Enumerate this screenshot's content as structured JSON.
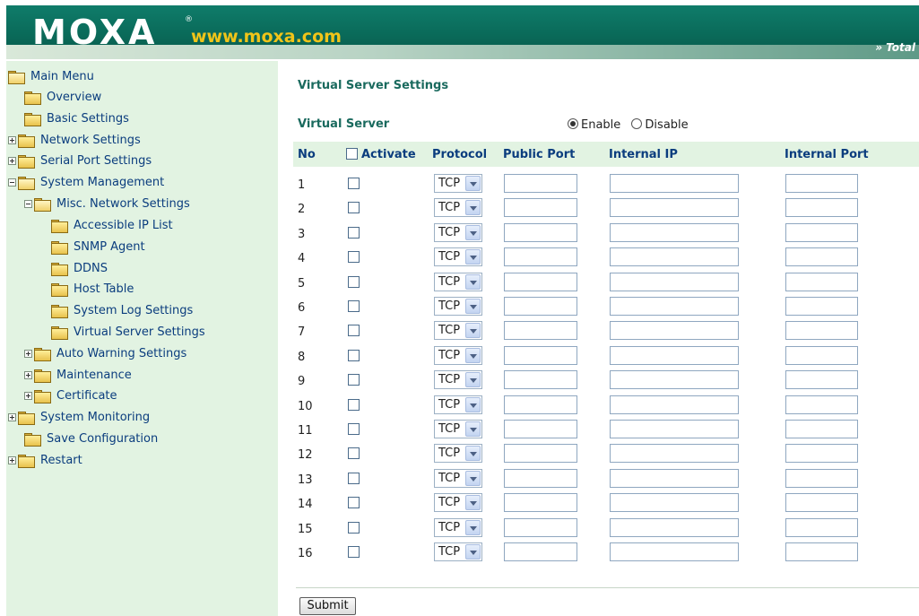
{
  "header": {
    "logo": "MOXA",
    "registered": "®",
    "url": "www.moxa.com",
    "tagline": "» Total"
  },
  "sidebar": {
    "items": [
      {
        "label": "Main Menu",
        "state": "open"
      },
      {
        "label": "Overview"
      },
      {
        "label": "Basic Settings"
      },
      {
        "label": "Network Settings",
        "state": "collapsed"
      },
      {
        "label": "Serial Port Settings",
        "state": "collapsed"
      },
      {
        "label": "System Management",
        "state": "open"
      },
      {
        "label": "Misc. Network Settings",
        "state": "open"
      },
      {
        "label": "Accessible IP List"
      },
      {
        "label": "SNMP Agent"
      },
      {
        "label": "DDNS"
      },
      {
        "label": "Host Table"
      },
      {
        "label": "System Log Settings"
      },
      {
        "label": "Virtual Server Settings"
      },
      {
        "label": "Auto Warning Settings",
        "state": "collapsed"
      },
      {
        "label": "Maintenance",
        "state": "collapsed"
      },
      {
        "label": "Certificate",
        "state": "collapsed"
      },
      {
        "label": "System Monitoring",
        "state": "collapsed"
      },
      {
        "label": "Save Configuration"
      },
      {
        "label": "Restart",
        "state": "collapsed"
      }
    ]
  },
  "main": {
    "title": "Virtual Server Settings",
    "virtual_server": {
      "label": "Virtual Server",
      "enable": "Enable",
      "disable": "Disable",
      "selected": "Enable"
    },
    "table": {
      "headers": {
        "no": "No",
        "activate": "Activate",
        "protocol": "Protocol",
        "public_port": "Public Port",
        "internal_ip": "Internal IP",
        "internal_port": "Internal Port"
      },
      "rows": [
        {
          "no": "1",
          "protocol": "TCP"
        },
        {
          "no": "2",
          "protocol": "TCP"
        },
        {
          "no": "3",
          "protocol": "TCP"
        },
        {
          "no": "4",
          "protocol": "TCP"
        },
        {
          "no": "5",
          "protocol": "TCP"
        },
        {
          "no": "6",
          "protocol": "TCP"
        },
        {
          "no": "7",
          "protocol": "TCP"
        },
        {
          "no": "8",
          "protocol": "TCP"
        },
        {
          "no": "9",
          "protocol": "TCP"
        },
        {
          "no": "10",
          "protocol": "TCP"
        },
        {
          "no": "11",
          "protocol": "TCP"
        },
        {
          "no": "12",
          "protocol": "TCP"
        },
        {
          "no": "13",
          "protocol": "TCP"
        },
        {
          "no": "14",
          "protocol": "TCP"
        },
        {
          "no": "15",
          "protocol": "TCP"
        },
        {
          "no": "16",
          "protocol": "TCP"
        }
      ]
    },
    "submit_label": "Submit"
  },
  "colors": {
    "header_bg": "#0a6a59",
    "sidebar_bg": "#e2f3e2",
    "title": "#1a6a5e",
    "link": "#0b3d7e",
    "url": "#f0c419"
  }
}
